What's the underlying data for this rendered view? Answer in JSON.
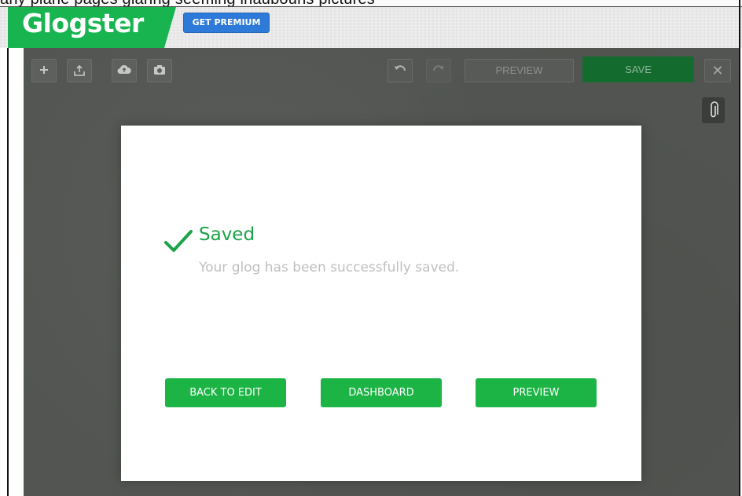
{
  "top_strip_text": "any plane pages glaring seeming inaubouns pictures",
  "header": {
    "logo_text": "Glogster",
    "premium_label": "GET PREMIUM"
  },
  "toolbar": {
    "left_tools": [
      {
        "icon": "plus-icon"
      },
      {
        "icon": "upload-icon"
      },
      {
        "icon": "cloud-icon"
      },
      {
        "icon": "camera-icon"
      }
    ],
    "undo_icon": "undo-icon",
    "redo_icon": "redo-icon",
    "preview_label": "PREVIEW",
    "save_label": "SAVE",
    "close_glyph": "✕",
    "attachment_icon": "paperclip-icon"
  },
  "modal": {
    "title": "Saved",
    "message": "Your glog has been successfully saved.",
    "buttons": {
      "back_to_edit": "BACK TO EDIT",
      "dashboard": "DASHBOARD",
      "preview": "PREVIEW"
    }
  },
  "colors": {
    "brand_green": "#17b44f",
    "button_green": "#1cb445",
    "premium_blue": "#2e7ad8",
    "overlay_gray": "#525551"
  }
}
